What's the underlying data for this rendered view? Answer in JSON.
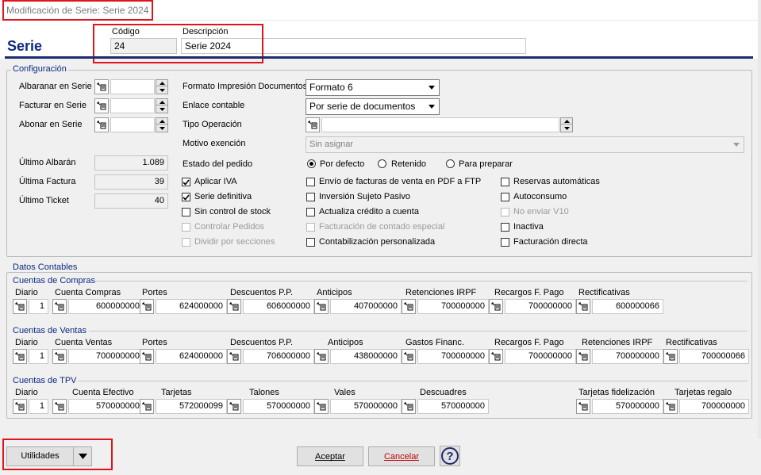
{
  "window": {
    "title": "Modificación de Serie: Serie 2024"
  },
  "header": {
    "heading": "Serie",
    "codigo_label": "Código",
    "codigo_value": "24",
    "descripcion_label": "Descripción",
    "descripcion_value": "Serie 2024"
  },
  "config": {
    "title": "Configuración",
    "albaranar_label": "Albaranar en Serie",
    "facturar_label": "Facturar en Serie",
    "abonar_label": "Abonar en Serie",
    "ultimo_albaran_label": "Último Albarán",
    "ultimo_albaran_value": "1.089",
    "ultima_factura_label": "Última Factura",
    "ultima_factura_value": "39",
    "ultimo_ticket_label": "Último Ticket",
    "ultimo_ticket_value": "40",
    "formato_label": "Formato Impresión Documentos",
    "formato_value": "Formato 6",
    "enlace_label": "Enlace contable",
    "enlace_value": "Por serie de documentos",
    "tipo_op_label": "Tipo Operación",
    "tipo_op_value": "",
    "motivo_label": "Motivo exención",
    "motivo_value": "Sin asignar",
    "estado_label": "Estado del pedido",
    "estado_options": [
      "Por defecto",
      "Retenido",
      "Para preparar"
    ],
    "estado_selected": "Por defecto",
    "checks_col1": [
      {
        "label": "Aplicar IVA",
        "checked": true,
        "disabled": false
      },
      {
        "label": "Serie definitiva",
        "checked": true,
        "disabled": false
      },
      {
        "label": "Sin control de stock",
        "checked": false,
        "disabled": false
      },
      {
        "label": "Controlar Pedidos",
        "checked": false,
        "disabled": true
      },
      {
        "label": "Dividir por secciones",
        "checked": false,
        "disabled": true
      }
    ],
    "checks_col2": [
      {
        "label": "Envío de facturas de venta en PDF a FTP",
        "checked": false,
        "disabled": false
      },
      {
        "label": "Inversión Sujeto Pasivo",
        "checked": false,
        "disabled": false
      },
      {
        "label": "Actualiza crédito a cuenta",
        "checked": false,
        "disabled": false
      },
      {
        "label": "Facturación de contado especial",
        "checked": false,
        "disabled": true
      },
      {
        "label": "Contabilización personalizada",
        "checked": false,
        "disabled": false
      }
    ],
    "checks_col3": [
      {
        "label": "Reservas automáticas",
        "checked": false,
        "disabled": false
      },
      {
        "label": "Autoconsumo",
        "checked": false,
        "disabled": false
      },
      {
        "label": "No enviar V10",
        "checked": false,
        "disabled": true
      },
      {
        "label": "Inactiva",
        "checked": false,
        "disabled": false
      },
      {
        "label": "Facturación directa",
        "checked": false,
        "disabled": false
      }
    ]
  },
  "contables": {
    "title": "Datos Contables",
    "compras": {
      "title": "Cuentas de Compras",
      "diario_label": "Diario",
      "diario_value": "1",
      "fields": [
        {
          "label": "Cuenta Compras",
          "value": "600000000"
        },
        {
          "label": "Portes",
          "value": "624000000"
        },
        {
          "label": "Descuentos P.P.",
          "value": "606000000"
        },
        {
          "label": "Anticipos",
          "value": "407000000"
        },
        {
          "label": "Retenciones IRPF",
          "value": "700000000"
        },
        {
          "label": "Recargos F. Pago",
          "value": "700000000"
        },
        {
          "label": "Rectificativas",
          "value": "600000066"
        }
      ]
    },
    "ventas": {
      "title": "Cuentas de Ventas",
      "diario_label": "Diario",
      "diario_value": "1",
      "fields": [
        {
          "label": "Cuenta Ventas",
          "value": "700000000"
        },
        {
          "label": "Portes",
          "value": "624000000"
        },
        {
          "label": "Descuentos P.P.",
          "value": "706000000"
        },
        {
          "label": "Anticipos",
          "value": "438000000"
        },
        {
          "label": "Gastos Financ.",
          "value": "700000000"
        },
        {
          "label": "Recargos F. Pago",
          "value": "700000000"
        },
        {
          "label": "Retenciones IRPF",
          "value": "700000000"
        },
        {
          "label": "Rectificativas",
          "value": "700000066"
        }
      ]
    },
    "tpv": {
      "title": "Cuentas de TPV",
      "diario_label": "Diario",
      "diario_value": "1",
      "fields": [
        {
          "label": "Cuenta Efectivo",
          "value": "570000000"
        },
        {
          "label": "Tarjetas",
          "value": "572000099"
        },
        {
          "label": "Talones",
          "value": "570000000"
        },
        {
          "label": "Vales",
          "value": "570000000"
        },
        {
          "label": "Descuadres",
          "value": "570000000"
        },
        {
          "label": "Tarjetas fidelización",
          "value": "570000000"
        },
        {
          "label": "Tarjetas regalo",
          "value": "700000000"
        }
      ]
    }
  },
  "footer": {
    "utilidades_label": "Utilidades",
    "aceptar_label": "Aceptar",
    "cancelar_label": "Cancelar",
    "help_glyph": "?"
  },
  "colors": {
    "accent": "#0c2980",
    "highlight": "#e0141b",
    "cancel": "#c00000"
  }
}
